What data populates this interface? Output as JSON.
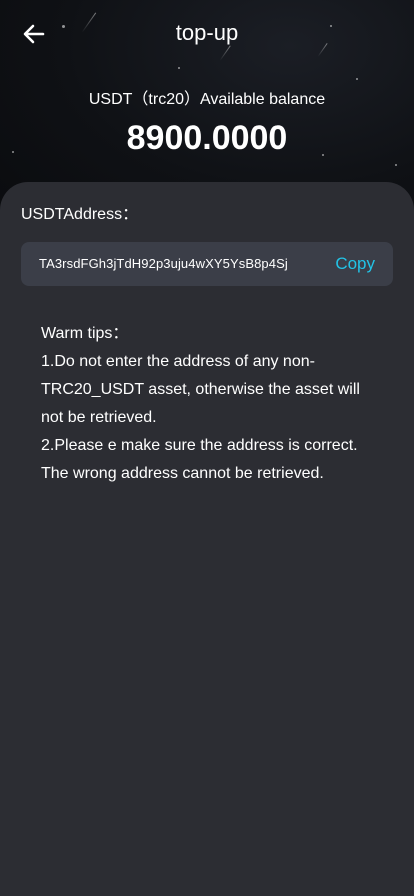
{
  "header": {
    "title": "top-up",
    "back_icon": "arrow-left-icon"
  },
  "balance": {
    "label": "USDT（trc20）Available balance",
    "value": "8900.0000"
  },
  "address": {
    "label": "USDTAddress：",
    "value": "TA3rsdFGh3jTdH92p3uju4wXY5YsB8p4Sj",
    "copy_label": "Copy"
  },
  "tips": {
    "title": "Warm tips：",
    "items": [
      "1.Do not enter the address of any non-TRC20_USDT asset, otherwise the asset will not be retrieved.",
      "2.Please e make sure the address is correct. The wrong address cannot be retrieved."
    ]
  },
  "colors": {
    "accent": "#22c3e6",
    "card_background": "#2c2d33",
    "address_box": "#3b3e48",
    "hero_background": "#0f1115"
  }
}
